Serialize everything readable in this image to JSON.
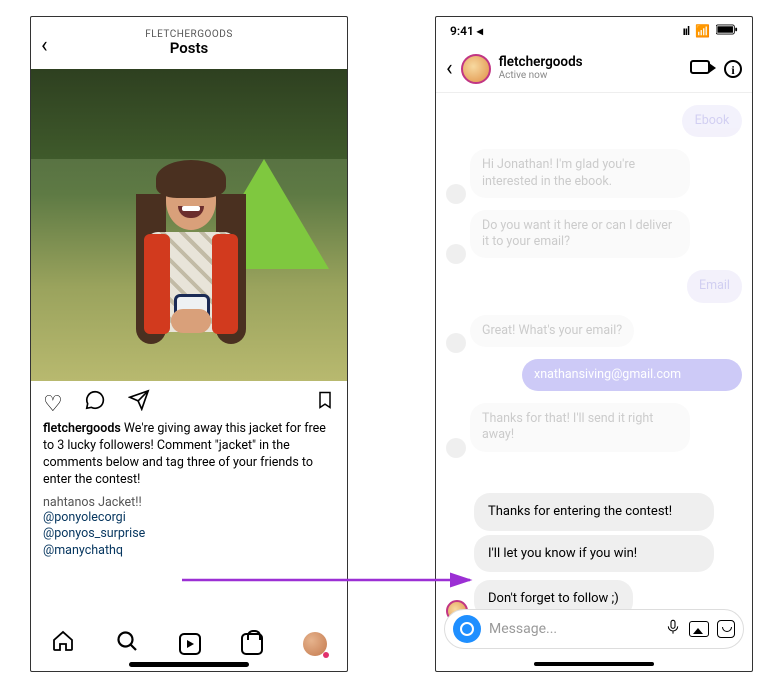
{
  "post": {
    "header_sub": "FLETCHERGOODS",
    "header_title": "Posts",
    "username": "fletchergoods",
    "caption": "We're giving away this jacket for free to 3 lucky followers! Comment \"jacket\" in the comments below and tag three of your friends to enter the contest!",
    "commenter": "nahtanos",
    "comment_text": "Jacket!!",
    "mentions": [
      "@ponyolecorgi",
      "@ponyos_surprise",
      "@manychathq"
    ]
  },
  "dm": {
    "status_time": "9:41",
    "username": "fletchergoods",
    "presence": "Active now",
    "faded": {
      "tag1": "Ebook",
      "m1": "Hi Jonathan! I'm glad you're interested in the ebook.",
      "m2": "Do you want it here or can I deliver it to your email?",
      "tag2": "Email",
      "m3": "Great! What's your email?",
      "m4": "xnathansiving@gmail.com",
      "m5": "Thanks for that! I'll send it right away!"
    },
    "msg1": "Thanks for entering the contest!",
    "msg2": "I'll let you know if you win!",
    "msg3": "Don't forget to follow ;)",
    "placeholder": "Message..."
  }
}
